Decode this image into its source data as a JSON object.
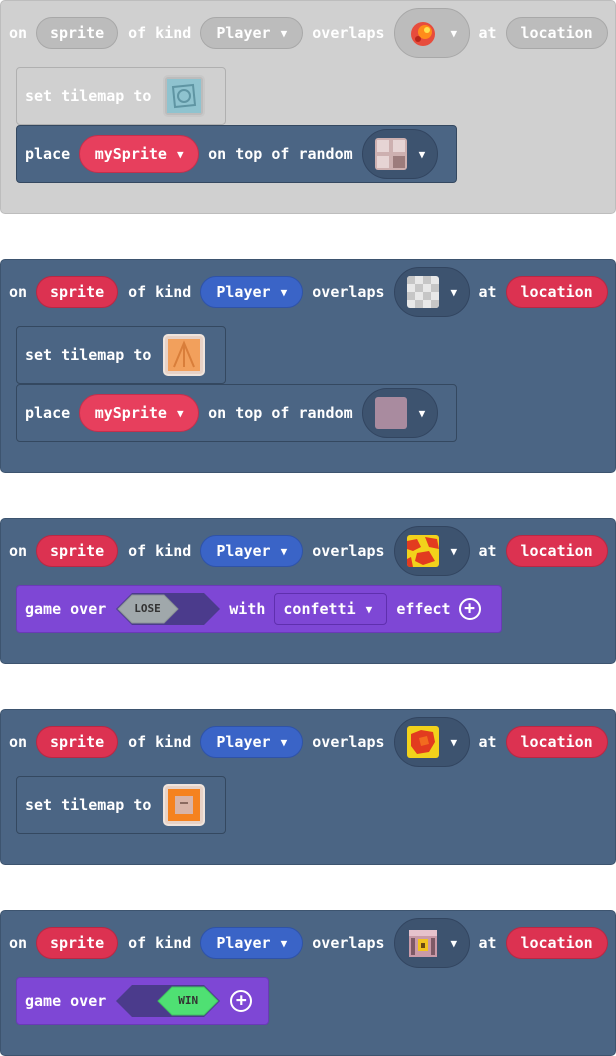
{
  "common": {
    "on": "on",
    "of_kind": "of kind",
    "overlaps": "overlaps",
    "at": "at",
    "sprite": "sprite",
    "player": "Player",
    "location": "location",
    "set_tilemap_to": "set tilemap to",
    "place": "place",
    "my_sprite": "mySprite",
    "on_top_of_random": "on top of random",
    "game_over": "game over",
    "with": "with",
    "effect": "effect",
    "caret": "▼"
  },
  "blocks": [
    {
      "state": "disabled",
      "tile_icon": "fire-tile-icon",
      "statements": [
        "set-tilemap",
        "place-sprite"
      ]
    },
    {
      "state": "enabled",
      "tile_icon": "checker-tile-icon",
      "statements": [
        "set-tilemap",
        "place-sprite"
      ]
    },
    {
      "state": "enabled",
      "tile_icon": "lava-tile-icon",
      "statements": [
        "game-over-lose"
      ],
      "lose_label": "LOSE",
      "effect_value": "confetti"
    },
    {
      "state": "enabled",
      "tile_icon": "lava-tile-icon",
      "statements": [
        "set-tilemap"
      ]
    },
    {
      "state": "enabled",
      "tile_icon": "chest-tile-icon",
      "statements": [
        "game-over-win"
      ],
      "win_label": "WIN"
    }
  ],
  "colors": {
    "disabled": "#d0d0d0",
    "event_block": "#4b6584",
    "sprite_red": "#dc3251",
    "kind_blue": "#3a64c7",
    "game_purple": "#7e47d5",
    "win_green": "#4fe073",
    "lose_gray": "#a0a8ab"
  }
}
